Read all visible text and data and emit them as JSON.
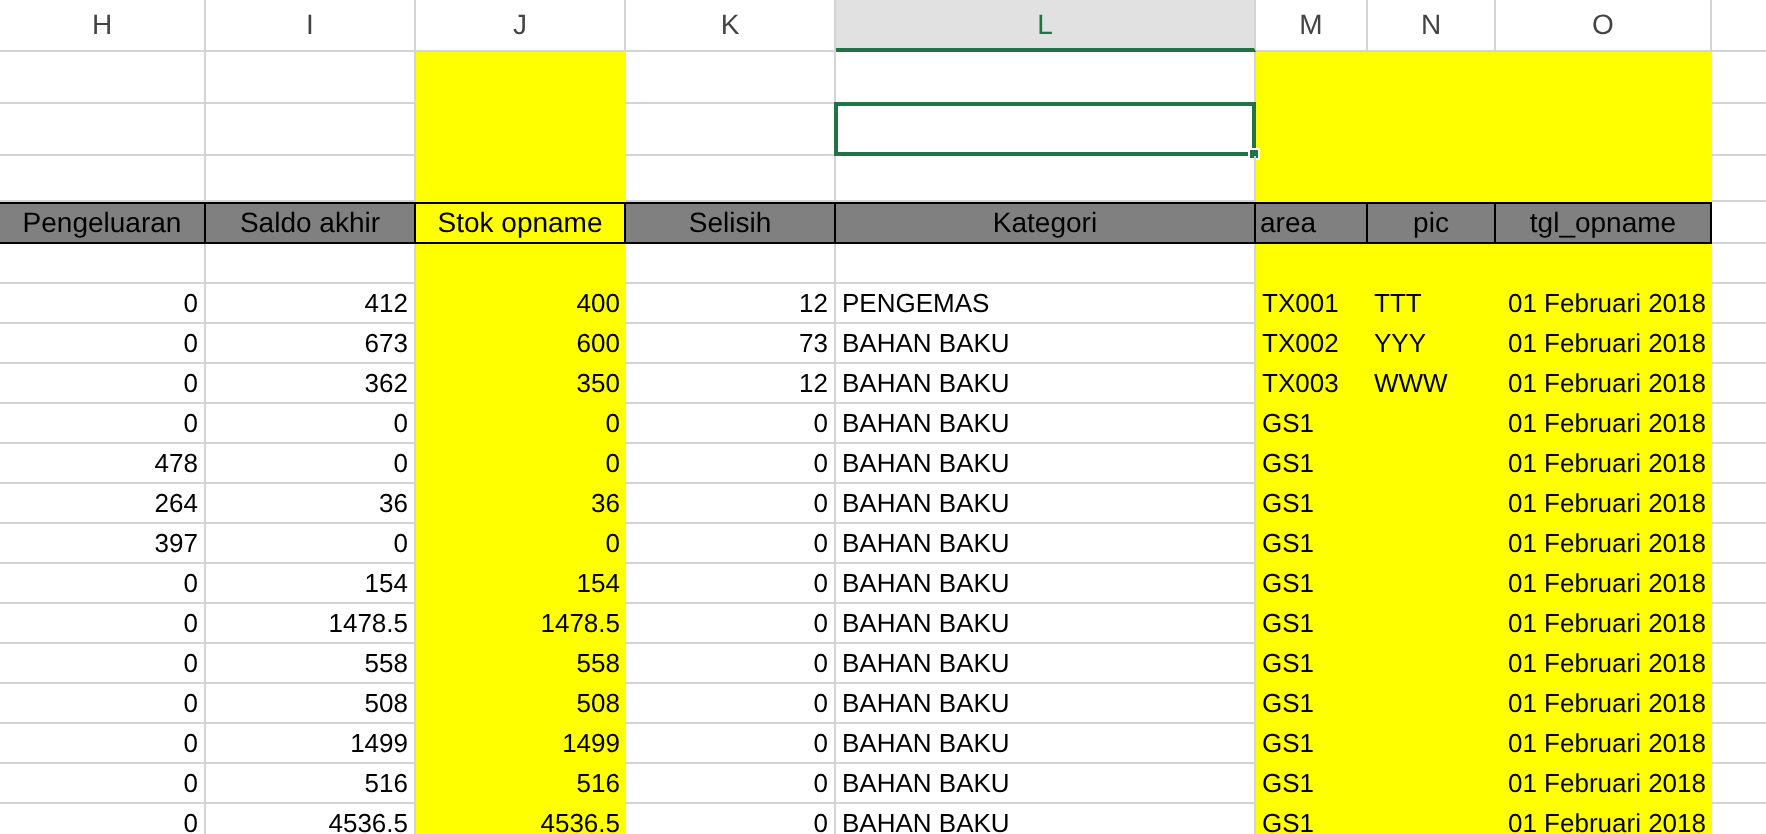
{
  "columns": [
    {
      "letter": "H",
      "heading": "Pengeluaran",
      "selected": false,
      "highlighted": false
    },
    {
      "letter": "I",
      "heading": "Saldo akhir",
      "selected": false,
      "highlighted": false
    },
    {
      "letter": "J",
      "heading": "Stok opname",
      "selected": false,
      "highlighted": true
    },
    {
      "letter": "K",
      "heading": "Selisih",
      "selected": false,
      "highlighted": false
    },
    {
      "letter": "L",
      "heading": "Kategori",
      "selected": true,
      "highlighted": false
    },
    {
      "letter": "M",
      "heading": "area",
      "selected": false,
      "highlighted": true
    },
    {
      "letter": "N",
      "heading": "pic",
      "selected": false,
      "highlighted": true
    },
    {
      "letter": "O",
      "heading": "tgl_opname",
      "selected": false,
      "highlighted": true
    }
  ],
  "rows": [
    {
      "pengeluaran": "0",
      "saldo_akhir": "412",
      "stok_opname": "400",
      "selisih": "12",
      "kategori": "PENGEMAS",
      "area": "TX001",
      "pic": "TTT",
      "tgl_opname": "01 Februari 2018"
    },
    {
      "pengeluaran": "0",
      "saldo_akhir": "673",
      "stok_opname": "600",
      "selisih": "73",
      "kategori": "BAHAN BAKU",
      "area": "TX002",
      "pic": "YYY",
      "tgl_opname": "01 Februari 2018"
    },
    {
      "pengeluaran": "0",
      "saldo_akhir": "362",
      "stok_opname": "350",
      "selisih": "12",
      "kategori": "BAHAN BAKU",
      "area": "TX003",
      "pic": "WWW",
      "tgl_opname": "01 Februari 2018"
    },
    {
      "pengeluaran": "0",
      "saldo_akhir": "0",
      "stok_opname": "0",
      "selisih": "0",
      "kategori": "BAHAN BAKU",
      "area": "GS1",
      "tgl_opname": "01 Februari 2018"
    },
    {
      "pengeluaran": "478",
      "saldo_akhir": "0",
      "stok_opname": "0",
      "selisih": "0",
      "kategori": "BAHAN BAKU",
      "area": "GS1",
      "tgl_opname": "01 Februari 2018"
    },
    {
      "pengeluaran": "264",
      "saldo_akhir": "36",
      "stok_opname": "36",
      "selisih": "0",
      "kategori": "BAHAN BAKU",
      "area": "GS1",
      "tgl_opname": "01 Februari 2018"
    },
    {
      "pengeluaran": "397",
      "saldo_akhir": "0",
      "stok_opname": "0",
      "selisih": "0",
      "kategori": "BAHAN BAKU",
      "area": "GS1",
      "tgl_opname": "01 Februari 2018"
    },
    {
      "pengeluaran": "0",
      "saldo_akhir": "154",
      "stok_opname": "154",
      "selisih": "0",
      "kategori": "BAHAN BAKU",
      "area": "GS1",
      "tgl_opname": "01 Februari 2018"
    },
    {
      "pengeluaran": "0",
      "saldo_akhir": "1478.5",
      "stok_opname": "1478.5",
      "selisih": "0",
      "kategori": "BAHAN BAKU",
      "area": "GS1",
      "tgl_opname": "01 Februari 2018"
    },
    {
      "pengeluaran": "0",
      "saldo_akhir": "558",
      "stok_opname": "558",
      "selisih": "0",
      "kategori": "BAHAN BAKU",
      "area": "GS1",
      "tgl_opname": "01 Februari 2018"
    },
    {
      "pengeluaran": "0",
      "saldo_akhir": "508",
      "stok_opname": "508",
      "selisih": "0",
      "kategori": "BAHAN BAKU",
      "area": "GS1",
      "tgl_opname": "01 Februari 2018"
    },
    {
      "pengeluaran": "0",
      "saldo_akhir": "1499",
      "stok_opname": "1499",
      "selisih": "0",
      "kategori": "BAHAN BAKU",
      "area": "GS1",
      "tgl_opname": "01 Februari 2018"
    },
    {
      "pengeluaran": "0",
      "saldo_akhir": "516",
      "stok_opname": "516",
      "selisih": "0",
      "kategori": "BAHAN BAKU",
      "area": "GS1",
      "tgl_opname": "01 Februari 2018"
    },
    {
      "pengeluaran": "0",
      "saldo_akhir": "4536.5",
      "stok_opname": "4536.5",
      "selisih": "0",
      "kategori": "BAHAN BAKU",
      "area": "GS1",
      "tgl_opname": "01 Februari 2018"
    }
  ]
}
